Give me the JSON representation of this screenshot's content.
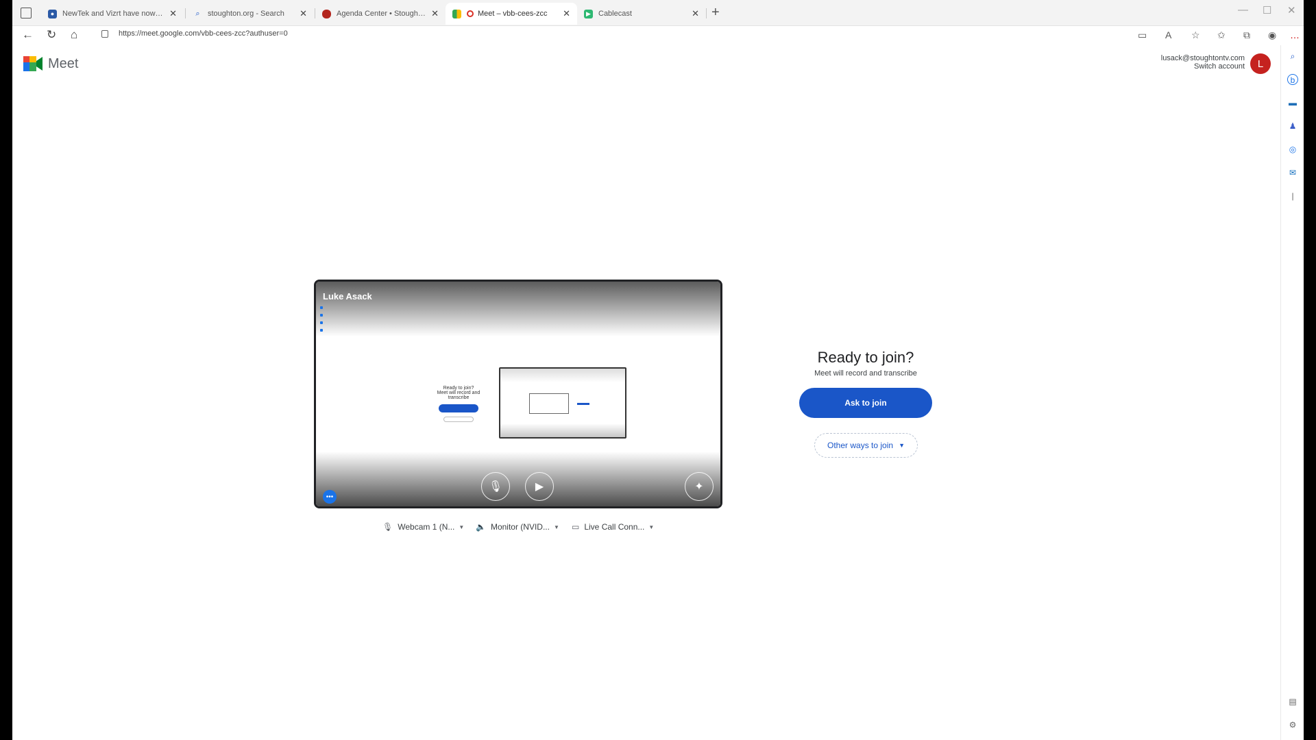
{
  "browser": {
    "tabs": [
      {
        "title": "NewTek and Vizrt have now join"
      },
      {
        "title": "stoughton.org - Search"
      },
      {
        "title": "Agenda Center • Stoughton, MA"
      },
      {
        "title": "Meet – vbb-cees-zcc"
      },
      {
        "title": "Cablecast"
      }
    ],
    "new_tab": "+",
    "url": "https://meet.google.com/vbb-cees-zcc?authuser=0"
  },
  "meet": {
    "brand": "Meet",
    "account_email": "lusack@stoughtontv.com",
    "switch_account": "Switch account",
    "avatar_letter": "L"
  },
  "preview": {
    "participant_name": "Luke Asack",
    "mini_title": "Ready to join?",
    "mini_sub": "Meet will record and transcribe"
  },
  "devices": {
    "mic": "Webcam 1 (N...",
    "speaker": "Monitor (NVID...",
    "camera": "Live Call Conn..."
  },
  "join": {
    "title": "Ready to join?",
    "subtitle": "Meet will record and transcribe",
    "ask_button": "Ask to join",
    "other_button": "Other ways to join"
  },
  "colors": {
    "primary": "#1a56c8",
    "avatar": "#c5221f"
  }
}
